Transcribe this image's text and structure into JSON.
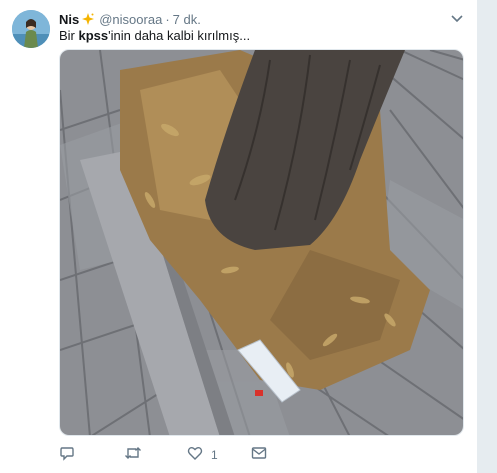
{
  "tweet": {
    "display_name": "Nis",
    "name_emoji": "sparkle-star-icon",
    "handle": "@nisooraa",
    "separator": "·",
    "time": "7 dk.",
    "text_before": "Bir ",
    "text_bold": "kpss",
    "text_after": "'inin daha kalbi kırılmış...",
    "media_alt": "photo",
    "actions": {
      "reply_icon": "reply-icon",
      "retweet_icon": "retweet-icon",
      "like_icon": "heart-icon",
      "like_count": "1",
      "dm_icon": "envelope-icon"
    }
  },
  "colors": {
    "background": "#e6ecf0",
    "card": "#ffffff",
    "secondary_text": "#657786",
    "accent": "#1da1f2"
  }
}
